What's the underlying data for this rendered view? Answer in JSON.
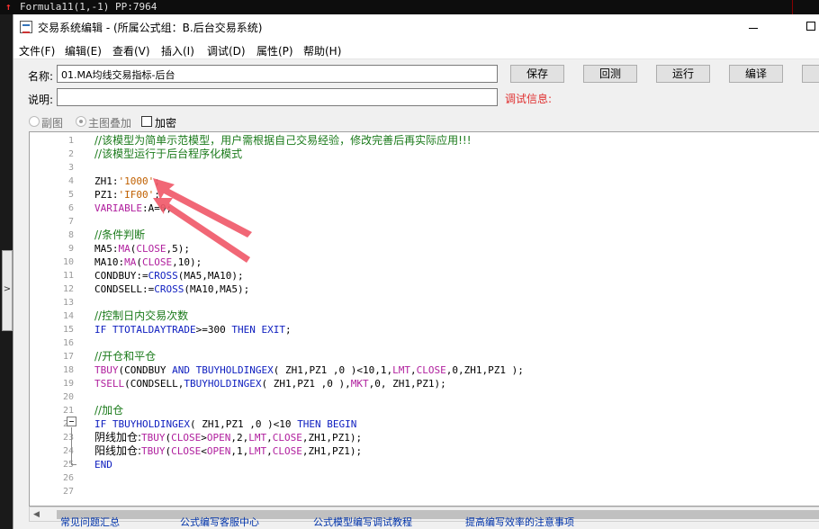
{
  "background_app": {
    "top_text": "Formula11(1,-1) PP:7964",
    "side_button_glyph": ">"
  },
  "window": {
    "title": "交易系统编辑 - (所属公式组：B.后台交易系统)"
  },
  "menu": [
    "文件(F)",
    "编辑(E)",
    "查看(V)",
    "插入(I)",
    "调试(D)",
    "属性(P)",
    "帮助(H)"
  ],
  "form": {
    "name_label": "名称:",
    "name_value": "01.MA均线交易指标-后台",
    "desc_label": "说明:",
    "desc_value": "",
    "debug_label": "调试信息:",
    "buttons": {
      "save": "保存",
      "backtest": "回测",
      "run": "运行",
      "compile": "编译"
    }
  },
  "options": {
    "sub_chart": "副图",
    "main_overlay": "主图叠加",
    "encrypt": "加密",
    "selected": "main_overlay"
  },
  "code": {
    "line_numbers": [
      "1",
      "2",
      "3",
      "4",
      "5",
      "6",
      "7",
      "8",
      "9",
      "10",
      "11",
      "12",
      "13",
      "14",
      "15",
      "16",
      "17",
      "18",
      "19",
      "20",
      "21",
      "22",
      "23",
      "24",
      "25",
      "26",
      "27"
    ],
    "lines": {
      "l1": "//该模型为简单示范模型，用户需根据自己交易经验，修改完善后再实际应用!!!",
      "l2": "//该模型运行于后台程序化模式",
      "l4a": "ZH1:",
      "l4b": "'1000'",
      "l4c": ";",
      "l5a": "PZ1:",
      "l5b": "'IF00'",
      "l5c": ";",
      "l6a": "VARIABLE",
      "l6b": ":A=0;",
      "l8": "//条件判断",
      "l9a": "MA5:",
      "l9b": "MA",
      "l9c": "(",
      "l9d": "CLOSE",
      "l9e": ",5);",
      "l10a": "MA10:",
      "l10b": "MA",
      "l10c": "(",
      "l10d": "CLOSE",
      "l10e": ",10);",
      "l11a": "CONDBUY:=",
      "l11b": "CROSS",
      "l11c": "(MA5,MA10);",
      "l12a": "CONDSELL:=",
      "l12b": "CROSS",
      "l12c": "(MA10,MA5);",
      "l14": "//控制日内交易次数",
      "l15a": "IF ",
      "l15b": "TTOTALDAYTRADE",
      "l15c": ">=300 ",
      "l15d": "THEN EXIT",
      "l15e": ";",
      "l17": "//开仓和平仓",
      "l18a": "TBUY",
      "l18b": "(CONDBUY ",
      "l18c": "AND ",
      "l18d": "TBUYHOLDINGEX",
      "l18e": "( ZH1,PZ1 ,0 )<10,1,",
      "l18f": "LMT",
      "l18g": ",",
      "l18h": "CLOSE",
      "l18i": ",0,ZH1,PZ1 );",
      "l19a": "TSELL",
      "l19b": "(CONDSELL,",
      "l19c": "TBUYHOLDINGEX",
      "l19d": "( ZH1,PZ1 ,0 ),",
      "l19e": "MKT",
      "l19f": ",0, ZH1,PZ1);",
      "l21": "//加仓",
      "l22a": "IF ",
      "l22b": "TBUYHOLDINGEX",
      "l22c": "( ZH1,PZ1 ,0 )<10 ",
      "l22d": "THEN BEGIN",
      "l23a": "阴线加仓:",
      "l23b": "TBUY",
      "l23c": "(",
      "l23d": "CLOSE",
      "l23e": ">",
      "l23f": "OPEN",
      "l23g": ",2,",
      "l23h": "LMT",
      "l23i": ",",
      "l23j": "CLOSE",
      "l23k": ",ZH1,PZ1);",
      "l24a": "阳线加仓:",
      "l24b": "TBUY",
      "l24c": "(",
      "l24d": "CLOSE",
      "l24e": "<",
      "l24f": "OPEN",
      "l24g": ",1,",
      "l24h": "LMT",
      "l24i": ",",
      "l24j": "CLOSE",
      "l24k": ",ZH1,PZ1);",
      "l25": "END"
    }
  },
  "bottom_links": [
    "常见问题汇总",
    "公式编写客服中心",
    "公式模型编写调试教程",
    "提高编写效率的注意事项"
  ],
  "colors": {
    "annotation_arrow": "#f05a6a",
    "comment": "#1a7a1a",
    "keyword": "#1020c0",
    "function": "#b0209e",
    "string": "#c06000",
    "debug_label": "#e03030"
  }
}
